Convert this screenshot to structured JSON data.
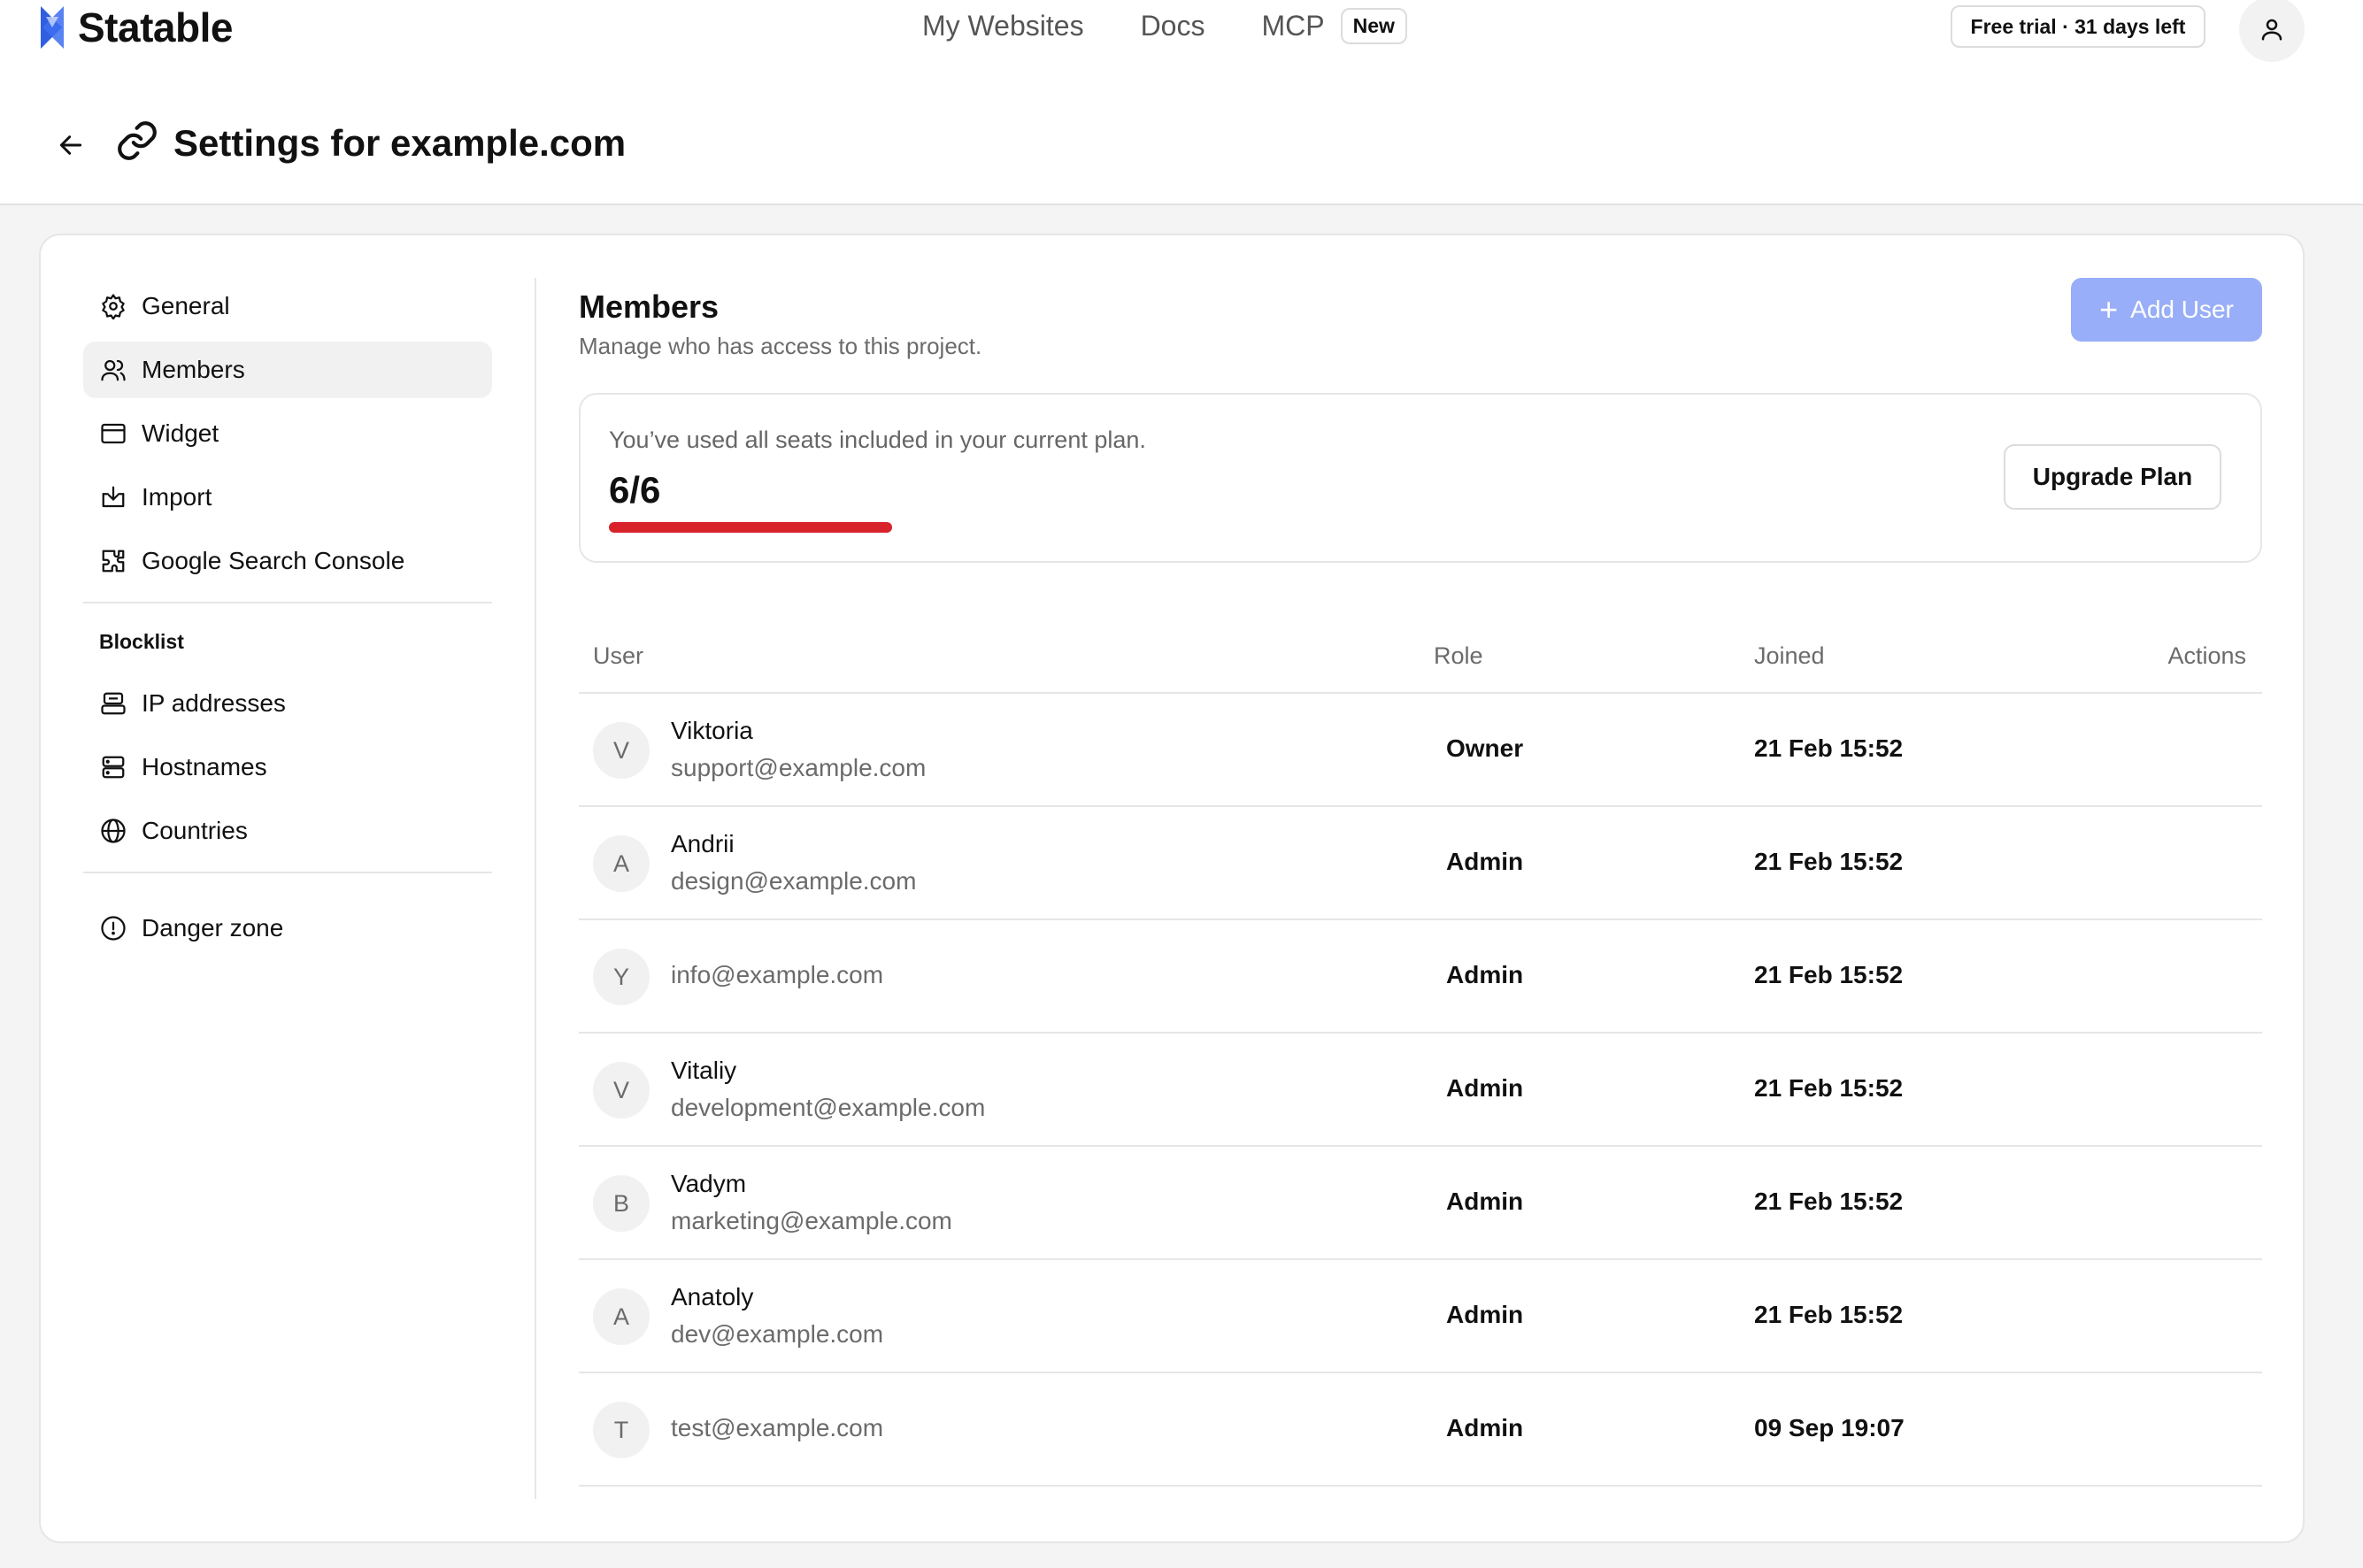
{
  "app": {
    "name": "Statable"
  },
  "nav": {
    "my_websites": "My Websites",
    "docs": "Docs",
    "mcp": "MCP",
    "mcp_badge": "New"
  },
  "trial": {
    "label": "Free trial · 31 days left"
  },
  "header": {
    "title": "Settings for example.com"
  },
  "sidebar": {
    "items": [
      {
        "label": "General",
        "icon": "gear-icon",
        "active": false
      },
      {
        "label": "Members",
        "icon": "users-icon",
        "active": true
      },
      {
        "label": "Widget",
        "icon": "browser-window-icon",
        "active": false
      },
      {
        "label": "Import",
        "icon": "import-icon",
        "active": false
      },
      {
        "label": "Google Search Console",
        "icon": "puzzle-icon",
        "active": false
      }
    ],
    "blocklist_heading": "Blocklist",
    "blocklist_items": [
      {
        "label": "IP addresses",
        "icon": "ip-icon"
      },
      {
        "label": "Hostnames",
        "icon": "server-icon"
      },
      {
        "label": "Countries",
        "icon": "globe-icon"
      }
    ],
    "danger": {
      "label": "Danger zone",
      "icon": "alert-circle-icon"
    }
  },
  "members": {
    "title": "Members",
    "subtitle": "Manage who has access to this project.",
    "add_user_label": "Add User",
    "seats": {
      "message": "You’ve used all seats included in your current plan.",
      "count_text": "6/6",
      "used_fraction": 1.0,
      "bar_color": "#d8232a",
      "upgrade_label": "Upgrade Plan"
    },
    "columns": {
      "user": "User",
      "role": "Role",
      "joined": "Joined",
      "actions": "Actions"
    },
    "rows": [
      {
        "initial": "V",
        "name": "Viktoria",
        "email": "support@example.com",
        "role": "Owner",
        "joined": "21 Feb 15:52"
      },
      {
        "initial": "A",
        "name": "Andrii",
        "email": "design@example.com",
        "role": "Admin",
        "joined": "21 Feb 15:52"
      },
      {
        "initial": "Y",
        "name": "",
        "email": "info@example.com",
        "role": "Admin",
        "joined": "21 Feb 15:52"
      },
      {
        "initial": "V",
        "name": "Vitaliy",
        "email": "development@example.com",
        "role": "Admin",
        "joined": "21 Feb 15:52"
      },
      {
        "initial": "B",
        "name": "Vadym",
        "email": "marketing@example.com",
        "role": "Admin",
        "joined": "21 Feb 15:52"
      },
      {
        "initial": "A",
        "name": "Anatoly",
        "email": "dev@example.com",
        "role": "Admin",
        "joined": "21 Feb 15:52"
      },
      {
        "initial": "T",
        "name": "",
        "email": "test@example.com",
        "role": "Admin",
        "joined": "09 Sep 19:07"
      }
    ]
  },
  "colors": {
    "accent_button": "#98aef8",
    "brand_logo": "#2f5fe0",
    "progress": "#d8232a"
  }
}
